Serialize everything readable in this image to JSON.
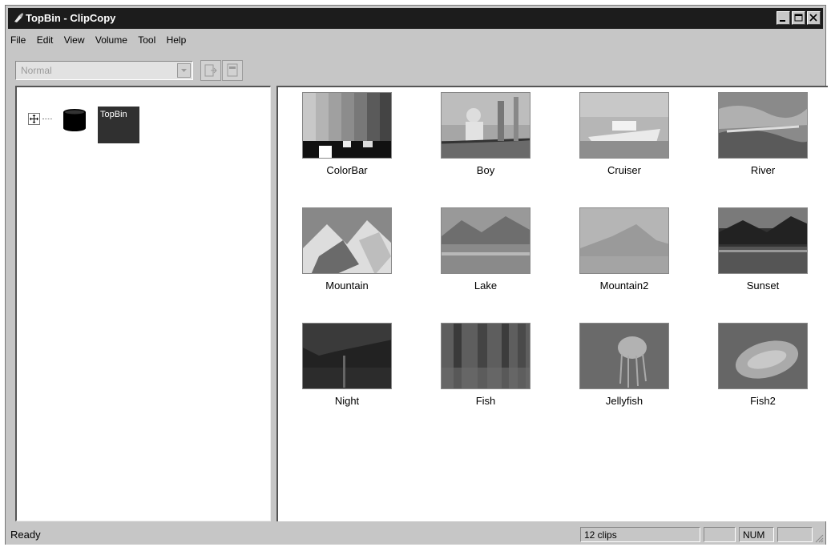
{
  "window": {
    "title": "TopBin - ClipCopy",
    "controls": [
      "minimize-icon",
      "maximize-icon",
      "close-icon"
    ]
  },
  "menu": [
    "File",
    "Edit",
    "View",
    "Volume",
    "Tool",
    "Help"
  ],
  "toolbar": {
    "mode_value": "Normal",
    "buttons": [
      "export-icon",
      "import-icon"
    ]
  },
  "tree": {
    "root_label": "TopBin",
    "root_icon": "database-icon",
    "expander_icon": "expand-icon"
  },
  "clips": [
    {
      "label": "ColorBar"
    },
    {
      "label": "Boy"
    },
    {
      "label": "Cruiser"
    },
    {
      "label": "River"
    },
    {
      "label": "Mountain"
    },
    {
      "label": "Lake"
    },
    {
      "label": "Mountain2"
    },
    {
      "label": "Sunset"
    },
    {
      "label": "Night"
    },
    {
      "label": "Fish"
    },
    {
      "label": "Jellyfish"
    },
    {
      "label": "Fish2"
    }
  ],
  "status": {
    "text": "Ready",
    "clip_count": "12 clips",
    "num_indicator": "NUM"
  },
  "colors": {
    "titlebar": "#1c1c1c",
    "chrome": "#c6c6c6",
    "pane": "#ffffff"
  }
}
